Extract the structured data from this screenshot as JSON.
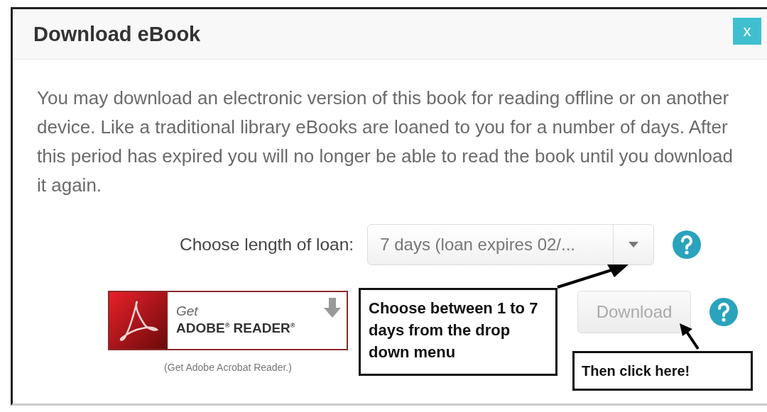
{
  "dialog": {
    "title": "Download eBook",
    "close_label": "x"
  },
  "description": "You may download an electronic version of this book for reading offline or on another device. Like a traditional library eBooks are loaned to you for a number of days. After this period has expired you will no longer be able to read the book until you download it again.",
  "loan": {
    "label": "Choose length of loan:",
    "value": "7 days (loan expires 02/..."
  },
  "adobe_badge": {
    "get": "Get",
    "product": "ADOBE$^{®}$ READER$^{®}$",
    "caption": "(Get Adobe Acrobat Reader.)"
  },
  "download_button": {
    "label": "Download",
    "disabled": true
  },
  "annotations": [
    {
      "kind": "dropdown",
      "text": "Choose between 1 to 7 days from the drop down menu"
    },
    {
      "kind": "download",
      "text": "Then click here!"
    }
  ]
}
